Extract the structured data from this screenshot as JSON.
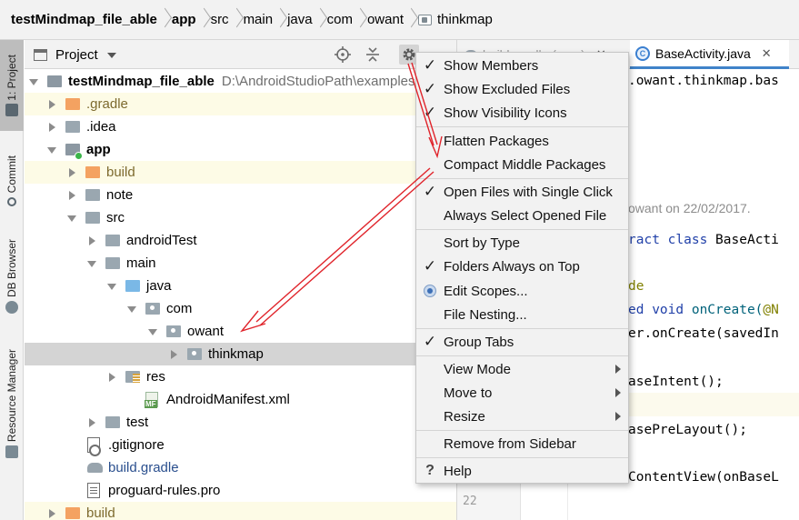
{
  "breadcrumb": {
    "items": [
      "testMindmap_file_able",
      "app",
      "src",
      "main",
      "java",
      "com",
      "owant",
      "thinkmap"
    ]
  },
  "tool_strip": {
    "project_label": "1: Project",
    "commit_label": "Commit",
    "db_label": "DB Browser",
    "resource_label": "Resource Manager"
  },
  "project_panel": {
    "title": "Project",
    "root": {
      "name": "testMindmap_file_able",
      "path": "D:\\AndroidStudioPath\\examples"
    },
    "rows": [
      {
        "label": ".gradle"
      },
      {
        "label": ".idea"
      },
      {
        "label": "app"
      },
      {
        "label": "build"
      },
      {
        "label": "note"
      },
      {
        "label": "src"
      },
      {
        "label": "androidTest"
      },
      {
        "label": "main"
      },
      {
        "label": "java"
      },
      {
        "label": "com"
      },
      {
        "label": "owant"
      },
      {
        "label": "thinkmap"
      },
      {
        "label": "res"
      },
      {
        "label": "AndroidManifest.xml"
      },
      {
        "label": "test"
      },
      {
        "label": ".gitignore"
      },
      {
        "label": "build.gradle"
      },
      {
        "label": "proguard-rules.pro"
      },
      {
        "label": "build"
      }
    ]
  },
  "editor": {
    "tab_hidden": "build.gradle (:app)",
    "tab_active": "BaseActivity.java",
    "lines": {
      "l1": ".owant.thinkmap.bas",
      "comment": "owant on 22/02/2017.",
      "l3a": "ract class",
      "l3b": "BaseActi",
      "l4": "de",
      "l5a": "ed void",
      "l5b": "onCreate(",
      "l5c": "@N",
      "l6": "er.onCreate(savedIn",
      "l7": "aseIntent();",
      "l8": "asePreLayout();",
      "l9": "ContentView(onBaseL"
    },
    "line_number": "22"
  },
  "menu": {
    "items": [
      {
        "label": "Show Members",
        "state": "check"
      },
      {
        "label": "Show Excluded Files",
        "state": "check"
      },
      {
        "label": "Show Visibility Icons",
        "state": "check"
      },
      {
        "label": "Flatten Packages",
        "state": ""
      },
      {
        "label": "Compact Middle Packages",
        "state": ""
      },
      {
        "label": "Open Files with Single Click",
        "state": "check"
      },
      {
        "label": "Always Select Opened File",
        "state": ""
      },
      {
        "label": "Sort by Type",
        "state": ""
      },
      {
        "label": "Folders Always on Top",
        "state": "check"
      },
      {
        "label": "Edit Scopes...",
        "state": "radio"
      },
      {
        "label": "File Nesting...",
        "state": ""
      },
      {
        "label": "Group Tabs",
        "state": "check"
      },
      {
        "label": "View Mode",
        "state": "submenu"
      },
      {
        "label": "Move to",
        "state": "submenu"
      },
      {
        "label": "Resize",
        "state": "submenu"
      },
      {
        "label": "Remove from Sidebar",
        "state": ""
      },
      {
        "label": "Help",
        "state": "help"
      }
    ]
  },
  "colors": {
    "annotation_arrow": "#e0242b",
    "selection": "#d4d4d4",
    "highlight_row": "#fdfbe6"
  }
}
